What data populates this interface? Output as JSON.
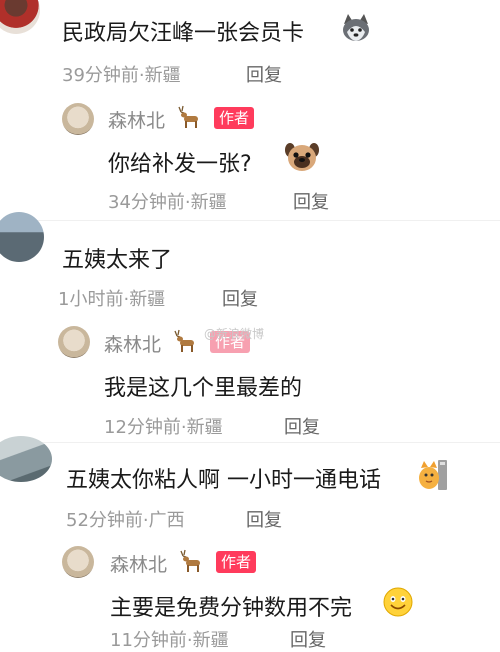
{
  "colors": {
    "author_tag": "#ff3b5c",
    "meta_text": "#9a9a9a",
    "body_text": "#1a1a1a"
  },
  "watermark": "@新浪微博",
  "comments": [
    {
      "text": "民政局欠汪峰一张会员卡",
      "emoji": "husky-dog-face-icon",
      "time": "39分钟前",
      "location": "新疆",
      "reply_label": "回复",
      "reply": {
        "username": "森林北",
        "author_tag": "作者",
        "text": "你给补发一张?",
        "emoji": "pug-face-icon",
        "time": "34分钟前",
        "location": "新疆",
        "reply_label": "回复"
      }
    },
    {
      "text": "五姨太来了",
      "time": "1小时前",
      "location": "新疆",
      "reply_label": "回复",
      "reply": {
        "username": "森林北",
        "author_tag": "作者",
        "text": "我是这几个里最差的",
        "time": "12分钟前",
        "location": "新疆",
        "reply_label": "回复"
      }
    },
    {
      "text": "五姨太你粘人啊 一小时一通电话",
      "emoji": "cat-phone-icon",
      "time": "52分钟前",
      "location": "广西",
      "reply_label": "回复",
      "reply": {
        "username": "森林北",
        "author_tag": "作者",
        "text": "主要是免费分钟数用不完",
        "emoji": "smile-face-icon",
        "time": "11分钟前",
        "location": "新疆",
        "reply_label": "回复"
      }
    }
  ]
}
